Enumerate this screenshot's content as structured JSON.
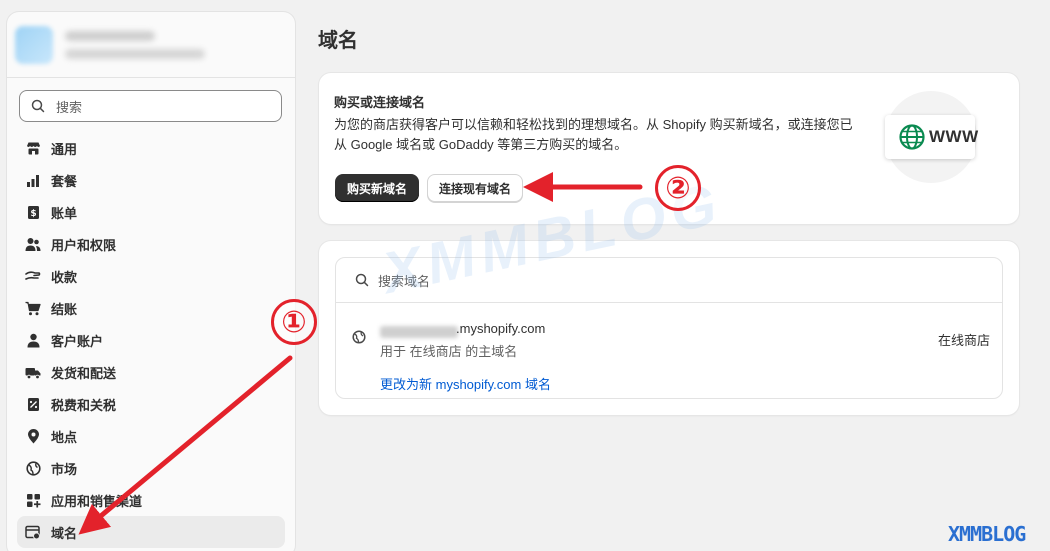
{
  "sidebar": {
    "search_placeholder": "搜索",
    "items": [
      {
        "label": "通用",
        "icon": "store-icon"
      },
      {
        "label": "套餐",
        "icon": "chart-bars-icon"
      },
      {
        "label": "账单",
        "icon": "billing-icon"
      },
      {
        "label": "用户和权限",
        "icon": "users-icon"
      },
      {
        "label": "收款",
        "icon": "payments-icon"
      },
      {
        "label": "结账",
        "icon": "cart-icon"
      },
      {
        "label": "客户账户",
        "icon": "person-icon"
      },
      {
        "label": "发货和配送",
        "icon": "truck-icon"
      },
      {
        "label": "税费和关税",
        "icon": "tax-icon"
      },
      {
        "label": "地点",
        "icon": "location-icon"
      },
      {
        "label": "市场",
        "icon": "globe-icon"
      },
      {
        "label": "应用和销售渠道",
        "icon": "apps-icon"
      },
      {
        "label": "域名",
        "icon": "domain-icon",
        "active": true
      }
    ]
  },
  "main": {
    "title": "域名",
    "buy_card": {
      "heading": "购买或连接域名",
      "description": "为您的商店获得客户可以信赖和轻松找到的理想域名。从 Shopify 购买新域名，或连接您已从 Google 域名或 GoDaddy 等第三方购买的域名。",
      "buy_button": "购买新域名",
      "connect_button": "连接现有域名",
      "illustration_text": "WWW"
    },
    "domains_card": {
      "search_placeholder": "搜索域名",
      "domain": {
        "name": ".myshopify.com",
        "usage": "用于 在线商店 的主域名",
        "change_link": "更改为新 myshopify.com 域名",
        "status": "在线商店"
      }
    }
  },
  "annotations": {
    "step1": "①",
    "step2": "②",
    "watermark": "XMMBLOG",
    "corner_watermark": "XMMBLOG",
    "arrow_color": "#e3222b"
  }
}
